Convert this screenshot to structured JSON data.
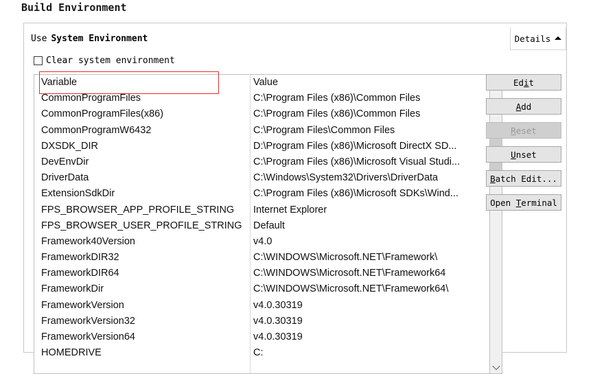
{
  "page_title": "Build Environment",
  "panel": {
    "use_system_environment": {
      "prefix_label": "Use",
      "bold_label": "System Environment"
    },
    "details_button": {
      "label": "Details",
      "icon": "caret-up-icon"
    },
    "clear_system_environment": {
      "label": "Clear system environment",
      "checked": false
    }
  },
  "table": {
    "headers": {
      "variable": "Variable",
      "value": "Value"
    },
    "rows": [
      {
        "variable": "CommonProgramFiles",
        "value": "C:\\Program Files (x86)\\Common Files"
      },
      {
        "variable": "CommonProgramFiles(x86)",
        "value": "C:\\Program Files (x86)\\Common Files"
      },
      {
        "variable": "CommonProgramW6432",
        "value": "C:\\Program Files\\Common Files"
      },
      {
        "variable": "DXSDK_DIR",
        "value": "D:\\Program Files (x86)\\Microsoft DirectX SD..."
      },
      {
        "variable": "DevEnvDir",
        "value": "C:\\Program Files (x86)\\Microsoft Visual Studi..."
      },
      {
        "variable": "DriverData",
        "value": "C:\\Windows\\System32\\Drivers\\DriverData"
      },
      {
        "variable": "ExtensionSdkDir",
        "value": "C:\\Program Files (x86)\\Microsoft SDKs\\Wind..."
      },
      {
        "variable": "FPS_BROWSER_APP_PROFILE_STRING",
        "value": "Internet Explorer"
      },
      {
        "variable": "FPS_BROWSER_USER_PROFILE_STRING",
        "value": "Default"
      },
      {
        "variable": "Framework40Version",
        "value": "v4.0"
      },
      {
        "variable": "FrameworkDIR32",
        "value": "C:\\WINDOWS\\Microsoft.NET\\Framework\\"
      },
      {
        "variable": "FrameworkDIR64",
        "value": "C:\\WINDOWS\\Microsoft.NET\\Framework64"
      },
      {
        "variable": "FrameworkDir",
        "value": "C:\\WINDOWS\\Microsoft.NET\\Framework64\\"
      },
      {
        "variable": "FrameworkVersion",
        "value": "v4.0.30319"
      },
      {
        "variable": "FrameworkVersion32",
        "value": "v4.0.30319"
      },
      {
        "variable": "FrameworkVersion64",
        "value": "v4.0.30319"
      },
      {
        "variable": "HOMEDRIVE",
        "value": "C:"
      }
    ]
  },
  "scrollbar": {
    "up_icon": "chevron-up-icon",
    "down_icon": "chevron-down-icon"
  },
  "actions": [
    {
      "id": "edit",
      "pre": "Ed",
      "accel": "i",
      "post": "t",
      "disabled": false
    },
    {
      "id": "add",
      "pre": "",
      "accel": "A",
      "post": "dd",
      "disabled": false
    },
    {
      "id": "reset",
      "pre": "",
      "accel": "R",
      "post": "eset",
      "disabled": true
    },
    {
      "id": "unset",
      "pre": "",
      "accel": "U",
      "post": "nset",
      "disabled": false
    },
    {
      "id": "batch-edit",
      "pre": "",
      "accel": "B",
      "post": "atch Edit...",
      "disabled": false
    },
    {
      "id": "open-terminal",
      "pre": "Open ",
      "accel": "T",
      "post": "erminal",
      "disabled": false
    }
  ],
  "colors": {
    "highlight": "#e03030",
    "panel_border": "#c8c8c8",
    "button_face": "#e4e4e4",
    "scrollbar_thumb": "#cdcdcd"
  }
}
